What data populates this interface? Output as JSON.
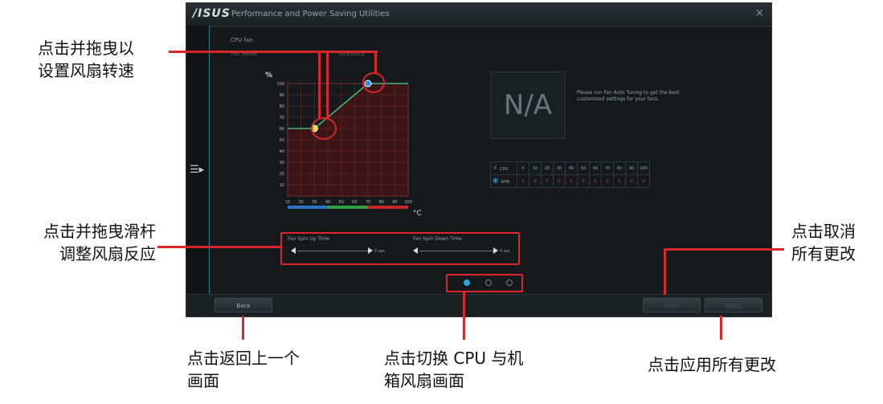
{
  "window": {
    "logo": "/ISUS",
    "title": "Performance and Power Saving Utilities",
    "close": "×"
  },
  "panel": {
    "cpu_fan_label": "CPU fan",
    "mode_label": "Fan Mode",
    "preset_label": "Standard"
  },
  "chart_data": {
    "type": "line",
    "ylabel": "%",
    "xlabel": "°C",
    "x_ticks": [
      10,
      20,
      30,
      40,
      50,
      60,
      70,
      80,
      90,
      100
    ],
    "y_ticks": [
      10,
      20,
      30,
      40,
      50,
      60,
      70,
      80,
      90,
      100
    ],
    "xlim": [
      10,
      100
    ],
    "ylim": [
      0,
      100
    ],
    "grid": true,
    "series": [
      {
        "x": [
          10,
          30,
          70,
          100
        ],
        "y": [
          60,
          60,
          100,
          100
        ]
      }
    ],
    "handles": [
      {
        "x": 30,
        "y": 60,
        "color": "#e8d23a"
      },
      {
        "x": 70,
        "y": 100,
        "color": "#3b86d8"
      }
    ],
    "zone_colors": [
      "#2f6fc4",
      "#2f9e46",
      "#c8272a"
    ]
  },
  "na_panel": {
    "text": "N/A",
    "desc": "Please run Fan Auto Tuning to get the best customized settings for your fans."
  },
  "table": {
    "temp_icon": "⚡",
    "rpm_icon": "✻",
    "temp_label": "CPU",
    "rpm_label": "RPM",
    "temp_values": [
      "0",
      "10",
      "20",
      "30",
      "40",
      "50",
      "60",
      "70",
      "80",
      "90",
      "100"
    ],
    "rpm_values": [
      "0",
      "0",
      "0",
      "0",
      "0",
      "0",
      "0",
      "0",
      "0",
      "0",
      "0"
    ],
    "rpm_color": "#d03a3a"
  },
  "sliders": {
    "spin_up_label": "Fan Spin Up Time",
    "spin_down_label": "Fan Spin Down Time",
    "spin_up_value": "0 sec",
    "spin_down_value": "0 sec"
  },
  "pager": {
    "pages": 3,
    "active": 0
  },
  "buttons": {
    "back": "Back",
    "undo": "Undo",
    "apply": "Apply"
  },
  "annotations": {
    "drag_points_l1": "点击并拖曳以",
    "drag_points_l2": "设置风扇转速",
    "drag_slider_l1": "点击并拖曳滑杆",
    "drag_slider_l2": "调整风扇反应",
    "undo_l1": "点击取消",
    "undo_l2": "所有更改",
    "back_l1": "点击返回上一个",
    "back_l2": "画面",
    "switch_l1": "点击切换 CPU 与机",
    "switch_l2": "箱风扇画面",
    "apply_l1": "点击应用所有更改"
  },
  "colors": {
    "accent": "#2aa7e0",
    "annotation_red": "#d8262a",
    "curve": "#3fb97a"
  }
}
